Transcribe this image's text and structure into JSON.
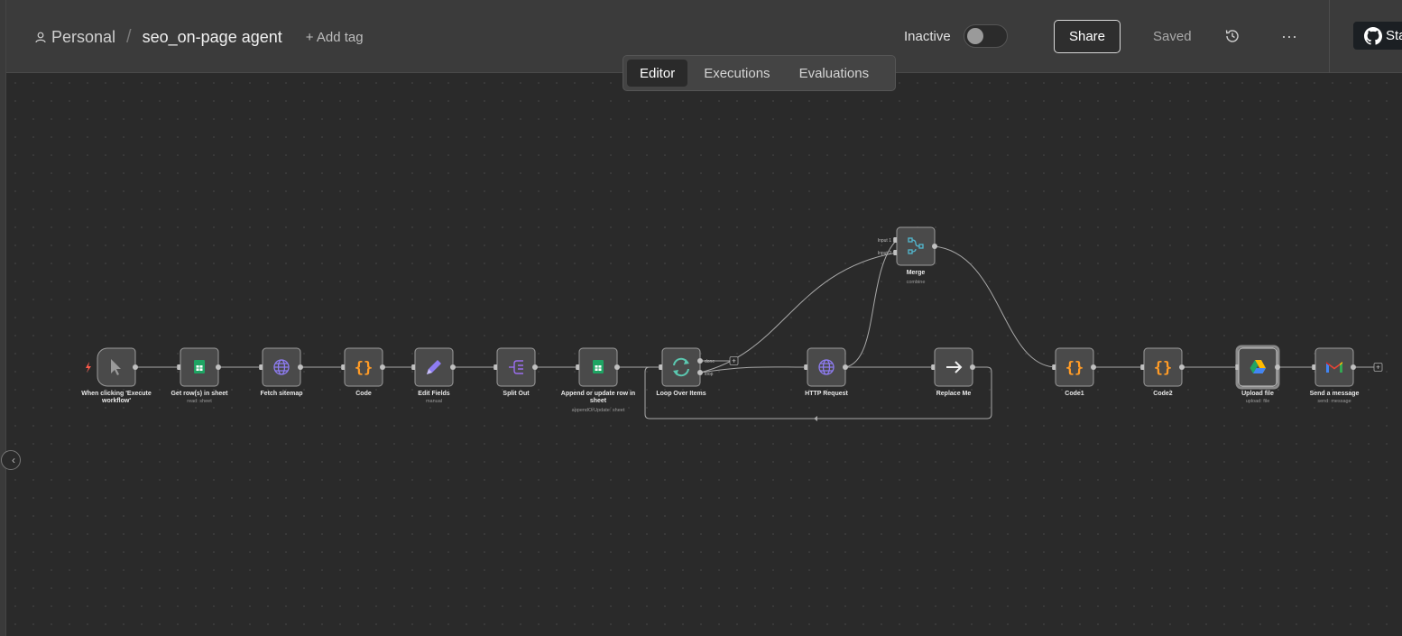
{
  "header": {
    "project": "Personal",
    "workflow_name": "seo_on-page agent",
    "add_tag": "+ Add tag",
    "status_label": "Inactive",
    "share": "Share",
    "saved": "Saved",
    "star": "Sta",
    "more": "···"
  },
  "tabs": [
    "Editor",
    "Executions",
    "Evaluations"
  ],
  "active_tab": "Editor",
  "nodes": [
    {
      "id": "trigger",
      "label": "When clicking 'Execute",
      "label2": "workflow'",
      "sub": "",
      "icon": "cursor-icon"
    },
    {
      "id": "get-rows",
      "label": "Get row(s) in sheet",
      "sub": "read: sheet",
      "icon": "google-sheets-icon"
    },
    {
      "id": "fetch-sitemap",
      "label": "Fetch sitemap",
      "sub": "",
      "icon": "globe-icon"
    },
    {
      "id": "code",
      "label": "Code",
      "sub": "",
      "icon": "code-braces-icon"
    },
    {
      "id": "edit-fields",
      "label": "Edit Fields",
      "sub": "manual",
      "icon": "pencil-icon"
    },
    {
      "id": "split-out",
      "label": "Split Out",
      "sub": "",
      "icon": "split-icon"
    },
    {
      "id": "append-row",
      "label": "Append or update row in",
      "label2": "sheet",
      "sub": "appendOrUpdate: sheet",
      "icon": "google-sheets-icon"
    },
    {
      "id": "loop",
      "label": "Loop Over Items",
      "sub": "",
      "icon": "loop-icon"
    },
    {
      "id": "http",
      "label": "HTTP Request",
      "sub": "",
      "icon": "globe-icon"
    },
    {
      "id": "replace-me",
      "label": "Replace Me",
      "sub": "",
      "icon": "arrow-right-icon"
    },
    {
      "id": "merge",
      "label": "Merge",
      "sub": "combine",
      "icon": "merge-icon"
    },
    {
      "id": "code1",
      "label": "Code1",
      "sub": "",
      "icon": "code-braces-icon"
    },
    {
      "id": "code2",
      "label": "Code2",
      "sub": "",
      "icon": "code-braces-icon"
    },
    {
      "id": "upload-file",
      "label": "Upload file",
      "sub": "upload: file",
      "icon": "google-drive-icon"
    },
    {
      "id": "send-message",
      "label": "Send a message",
      "sub": "send: message",
      "icon": "gmail-icon"
    }
  ],
  "ports": {
    "loop_done": "done",
    "loop_loop": "loop",
    "merge_in1": "Input 1",
    "merge_in2": "Input 2"
  },
  "colors": {
    "code_orange": "#ff9b26",
    "sheets_green": "#1fa463",
    "globe_purple": "#8e7cf2",
    "loop_teal": "#5bc8b0",
    "merge_teal": "#52b8d0",
    "trigger_red": "#ff5a4a"
  }
}
